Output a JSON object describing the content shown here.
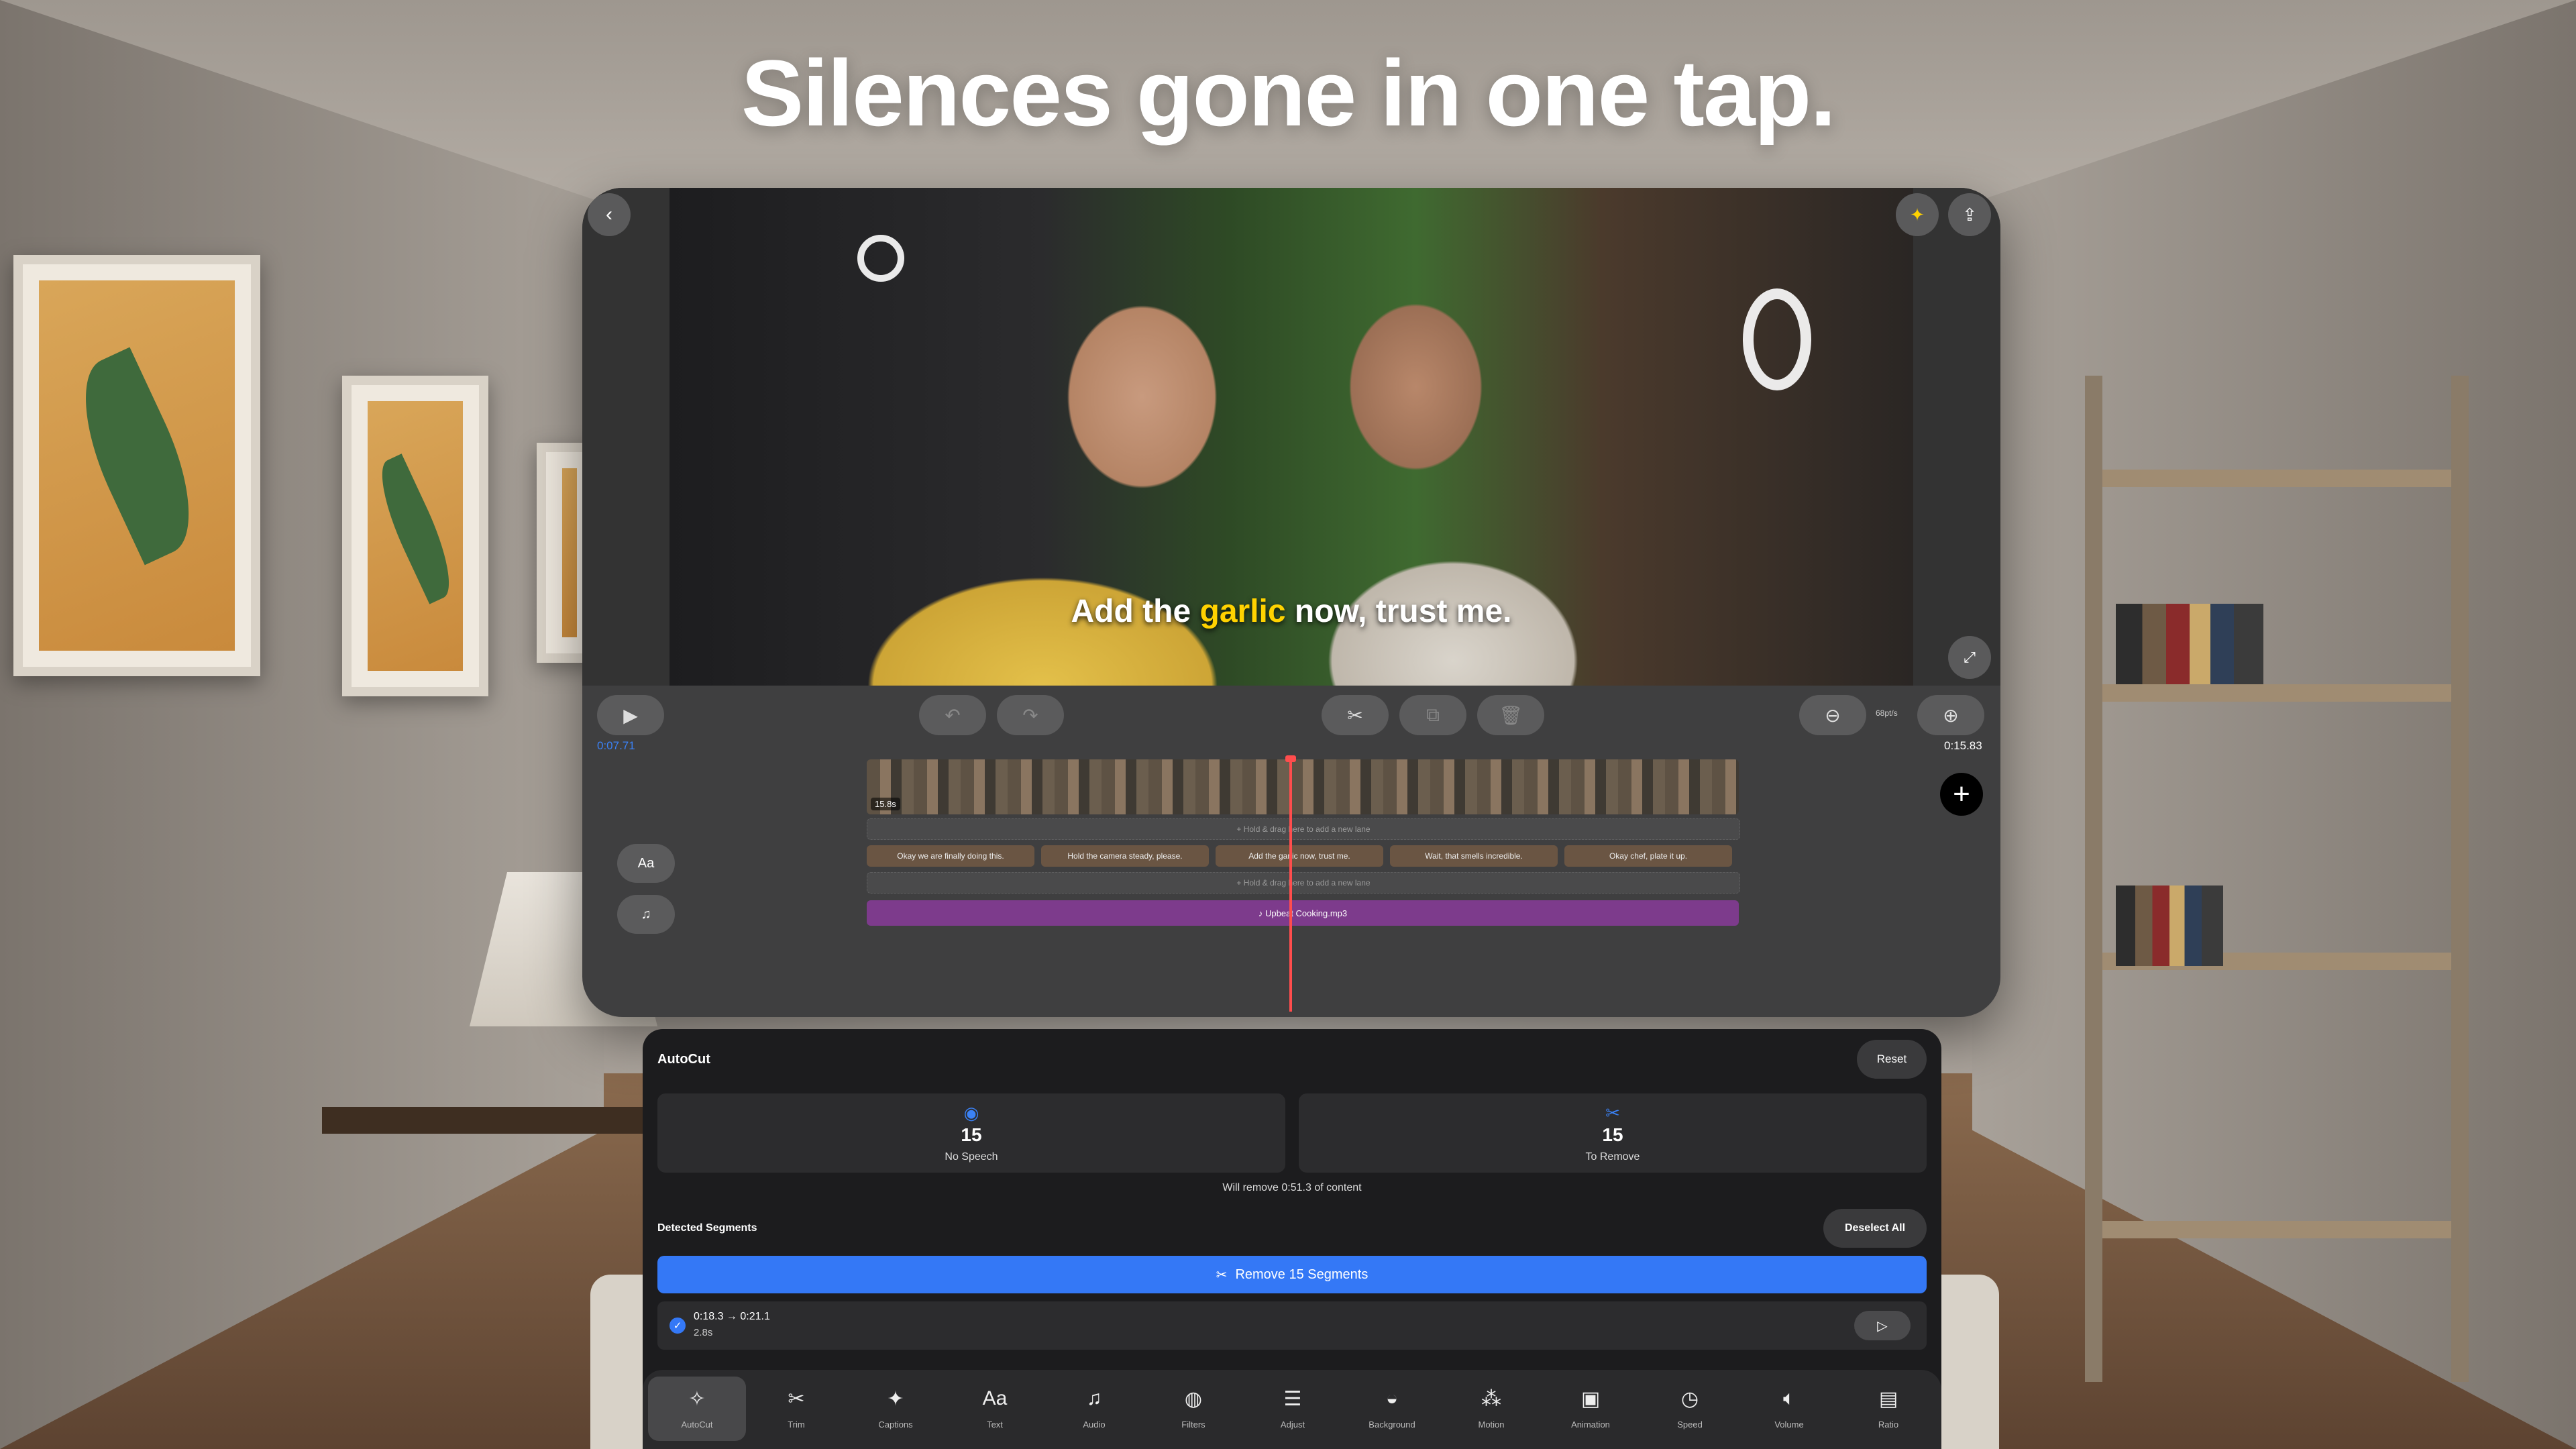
{
  "headline": "Silences gone in one tap.",
  "preview": {
    "subtitle": {
      "pre": "Add the ",
      "highlight": "garlic",
      "post": " now, trust me."
    },
    "back_icon": "chevron-left-icon",
    "sparkle_icon": "sparkle-icon",
    "share_icon": "share-icon",
    "expand_icon": "expand-icon"
  },
  "toolbar": {
    "current_time": "0:07.71",
    "total_time": "0:15.83",
    "zoom_label": "68pt/s"
  },
  "timeline": {
    "clip_duration": "15.8s",
    "lane_hint": "+ Hold & drag here to add a new lane",
    "captions": [
      "Okay we are finally doing this.",
      "Hold the camera steady, please.",
      "Add the garlic now, trust me.",
      "Wait, that smells incredible.",
      "Okay chef, plate it up."
    ],
    "audio_track": "♪ Upbeat Cooking.mp3",
    "text_lane_label": "Aa"
  },
  "autocut": {
    "title": "AutoCut",
    "reset": "Reset",
    "stats": [
      {
        "value": "15",
        "label": "No Speech"
      },
      {
        "value": "15",
        "label": "To Remove"
      }
    ],
    "summary": "Will remove 0:51.3 of content",
    "detected": "Detected Segments",
    "deselect": "Deselect All",
    "remove_button": "Remove 15 Segments",
    "segment": {
      "range": "0:18.3 → 0:21.1",
      "length": "2.8s"
    }
  },
  "tabs": [
    {
      "label": "AutoCut",
      "icon": "autocut-icon",
      "glyph": "✧"
    },
    {
      "label": "Trim",
      "icon": "scissors-icon",
      "glyph": "✂"
    },
    {
      "label": "Captions",
      "icon": "captions-icon",
      "glyph": "✦"
    },
    {
      "label": "Text",
      "icon": "text-icon",
      "glyph": "Aa"
    },
    {
      "label": "Audio",
      "icon": "audio-icon",
      "glyph": "♫"
    },
    {
      "label": "Filters",
      "icon": "filters-icon",
      "glyph": "◍"
    },
    {
      "label": "Adjust",
      "icon": "adjust-icon",
      "glyph": "☰"
    },
    {
      "label": "Background",
      "icon": "background-icon",
      "glyph": "◒"
    },
    {
      "label": "Motion",
      "icon": "motion-icon",
      "glyph": "⁂"
    },
    {
      "label": "Animation",
      "icon": "animation-icon",
      "glyph": "▣"
    },
    {
      "label": "Speed",
      "icon": "speed-icon",
      "glyph": "◷"
    },
    {
      "label": "Volume",
      "icon": "volume-icon",
      "glyph": "🔈︎"
    },
    {
      "label": "Ratio",
      "icon": "ratio-icon",
      "glyph": "▤"
    }
  ],
  "colors": {
    "accent": "#3478f6",
    "playhead": "#ff4d4d",
    "audio": "#7d3b8c",
    "highlight": "#ffd200"
  }
}
